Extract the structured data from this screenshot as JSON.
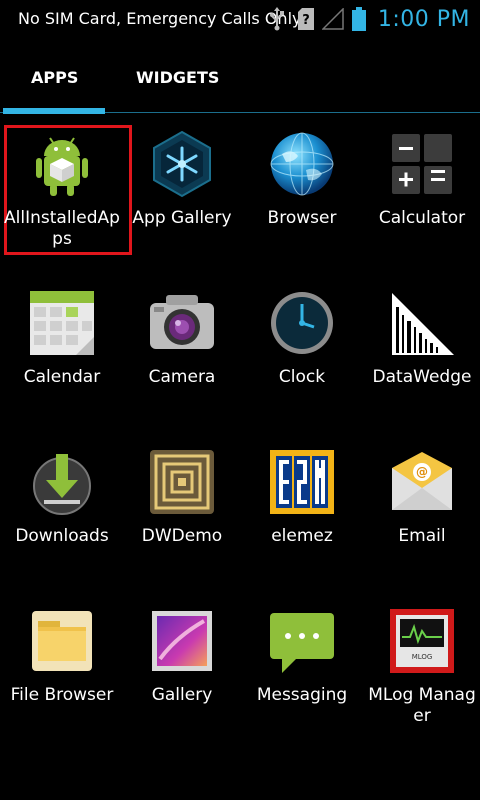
{
  "status_bar": {
    "carrier_text": "No SIM Card, Emergency Calls Only",
    "time": "1:00 PM",
    "icons": [
      "usb-icon",
      "no-sim-icon",
      "no-signal-icon",
      "battery-icon"
    ],
    "accent_color": "#33b5e5"
  },
  "tabs": [
    {
      "label": "APPS",
      "active": true
    },
    {
      "label": "WIDGETS",
      "active": false
    }
  ],
  "apps": [
    {
      "label": "AllInstalledApps",
      "icon": "android-box-icon",
      "selected": true
    },
    {
      "label": "App Gallery",
      "icon": "app-gallery-icon"
    },
    {
      "label": "Browser",
      "icon": "globe-icon"
    },
    {
      "label": "Calculator",
      "icon": "calculator-icon"
    },
    {
      "label": "Calendar",
      "icon": "calendar-icon"
    },
    {
      "label": "Camera",
      "icon": "camera-icon"
    },
    {
      "label": "Clock",
      "icon": "clock-icon"
    },
    {
      "label": "DataWedge",
      "icon": "barcode-icon"
    },
    {
      "label": "Downloads",
      "icon": "download-icon"
    },
    {
      "label": "DWDemo",
      "icon": "dwdemo-icon"
    },
    {
      "label": "elemez",
      "icon": "b2m-icon"
    },
    {
      "label": "Email",
      "icon": "email-icon"
    },
    {
      "label": "File Browser",
      "icon": "folder-icon"
    },
    {
      "label": "Gallery",
      "icon": "gallery-icon"
    },
    {
      "label": "Messaging",
      "icon": "messaging-icon"
    },
    {
      "label": "MLog Manager",
      "icon": "mlog-icon"
    }
  ],
  "selection_color": "#e0161c"
}
